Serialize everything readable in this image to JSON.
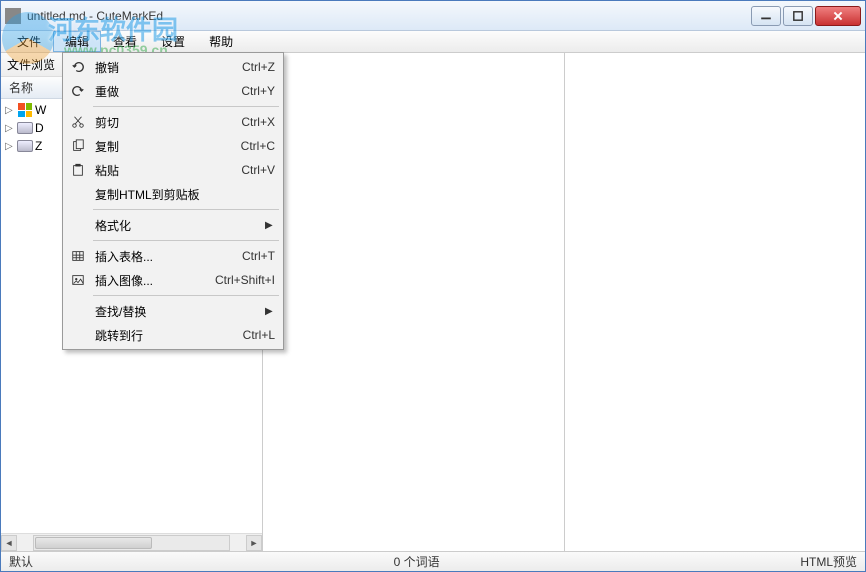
{
  "window": {
    "title": "untitled.md - CuteMarkEd"
  },
  "watermark": {
    "text1": "河东软件园",
    "text2": "www.pc0359.cn"
  },
  "menubar": {
    "items": [
      {
        "label": "文件"
      },
      {
        "label": "编辑"
      },
      {
        "label": "查看"
      },
      {
        "label": "设置"
      },
      {
        "label": "帮助"
      }
    ],
    "active_index": 1
  },
  "sidebar": {
    "title": "文件浏览",
    "column_header": "名称",
    "tree": [
      {
        "label": "W",
        "icon": "windows"
      },
      {
        "label": "D",
        "icon": "drive"
      },
      {
        "label": "Z",
        "icon": "drive"
      }
    ]
  },
  "dropdown": {
    "groups": [
      [
        {
          "icon": "undo",
          "label": "撤销",
          "shortcut": "Ctrl+Z"
        },
        {
          "icon": "redo",
          "label": "重做",
          "shortcut": "Ctrl+Y"
        }
      ],
      [
        {
          "icon": "cut",
          "label": "剪切",
          "shortcut": "Ctrl+X"
        },
        {
          "icon": "copy",
          "label": "复制",
          "shortcut": "Ctrl+C"
        },
        {
          "icon": "paste",
          "label": "粘贴",
          "shortcut": "Ctrl+V"
        },
        {
          "icon": "",
          "label": "复制HTML到剪贴板",
          "shortcut": ""
        }
      ],
      [
        {
          "icon": "",
          "label": "格式化",
          "shortcut": "",
          "submenu": true
        }
      ],
      [
        {
          "icon": "table",
          "label": "插入表格...",
          "shortcut": "Ctrl+T"
        },
        {
          "icon": "image",
          "label": "插入图像...",
          "shortcut": "Ctrl+Shift+I"
        }
      ],
      [
        {
          "icon": "",
          "label": "查找/替换",
          "shortcut": "",
          "submenu": true
        },
        {
          "icon": "",
          "label": "跳转到行",
          "shortcut": "Ctrl+L"
        }
      ]
    ]
  },
  "statusbar": {
    "left": "默认",
    "center": "0 个词语",
    "right": "HTML预览"
  }
}
